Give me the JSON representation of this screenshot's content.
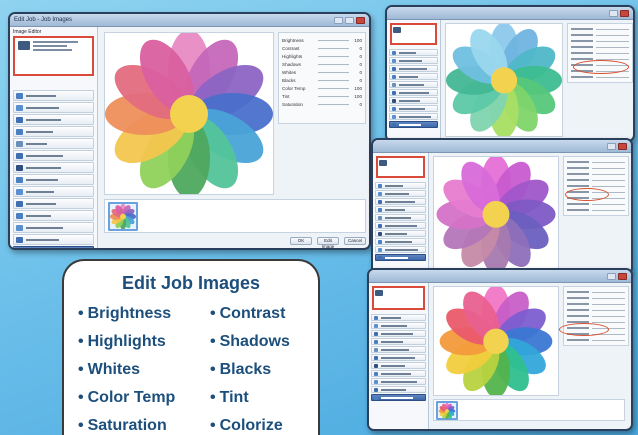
{
  "card": {
    "title": "Edit Job Images",
    "features_left": [
      "Brightness",
      "Highlights",
      "Whites",
      "Color Temp",
      "Saturation"
    ],
    "features_right": [
      "Contrast",
      "Shadows",
      "Blacks",
      "Tint",
      "Colorize"
    ],
    "bullet": "•"
  },
  "flower_colors": {
    "main": [
      "#e88bc4",
      "#c567b9",
      "#8c64c4",
      "#4a6fcb",
      "#4aa3d8",
      "#53c49a",
      "#4ea85e",
      "#8fd15a",
      "#f3c64e",
      "#ee8e5b",
      "#e26b7e",
      "#d95fa0"
    ],
    "variant_green": [
      "#8cc8ea",
      "#6fb4e0",
      "#4fb7c8",
      "#3dbd91",
      "#56c77a",
      "#7fd46a",
      "#a9de63",
      "#7fd4b0",
      "#5cc9a6",
      "#43b794",
      "#6fbfe0",
      "#9ad7ee"
    ],
    "variant_purple": [
      "#e56fd6",
      "#c95bd0",
      "#a056c9",
      "#7e5ac4",
      "#6a5fc0",
      "#8e6fba",
      "#a77ab0",
      "#c68aa7",
      "#b476b8",
      "#d572c8",
      "#e77ccf",
      "#d86ad9"
    ],
    "variant_vivid": [
      "#f177c6",
      "#c85ec8",
      "#7c5ed0",
      "#3b77d3",
      "#33a6d9",
      "#2fbf8f",
      "#53b34c",
      "#b7d23f",
      "#f1cd3d",
      "#f39a3c",
      "#ea5a6a",
      "#e9608f"
    ],
    "center": "#f3d24f"
  },
  "main_window": {
    "title": "Edit Job - Job Images",
    "panel_title": "Image Editor",
    "adjustments": [
      {
        "label": "Brightness",
        "value": "100"
      },
      {
        "label": "Contrast",
        "value": "0"
      },
      {
        "label": "Highlights",
        "value": "0"
      },
      {
        "label": "Shadows",
        "value": "0"
      },
      {
        "label": "Whites",
        "value": "0"
      },
      {
        "label": "Blacks",
        "value": "0"
      },
      {
        "label": "Color Temp",
        "value": "100"
      },
      {
        "label": "Tint",
        "value": "100"
      },
      {
        "label": "Saturation",
        "value": "0"
      }
    ],
    "buttons": [
      "OK",
      "Edit Image",
      "Cancel"
    ]
  },
  "accent": "#d94a3a"
}
